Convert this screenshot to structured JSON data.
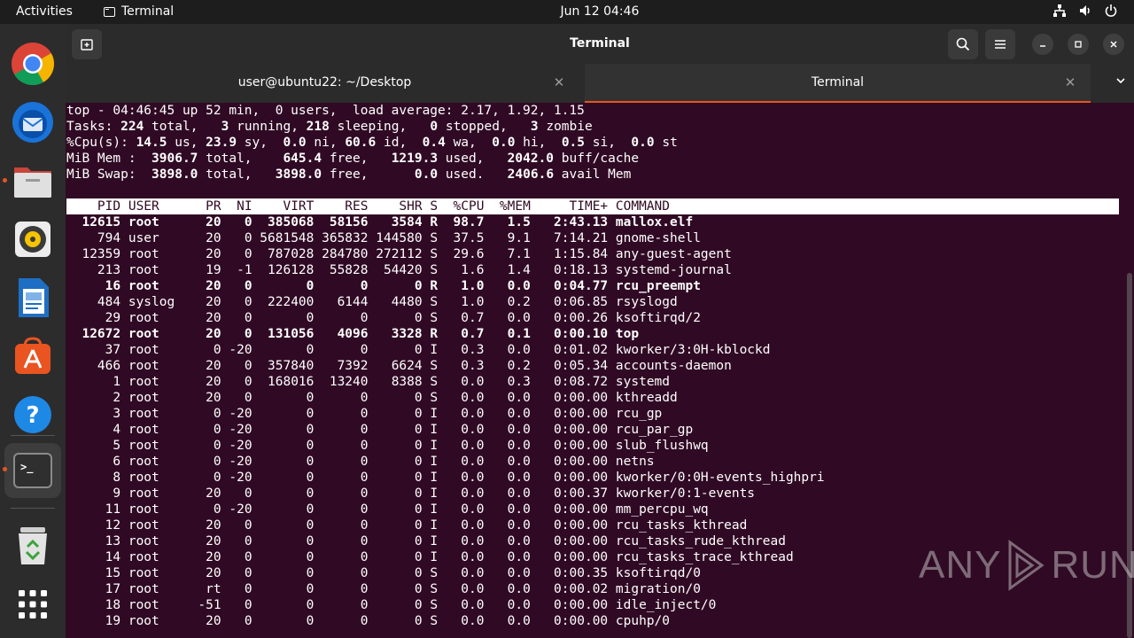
{
  "topbar": {
    "activities": "Activities",
    "app_name": "Terminal",
    "clock": "Jun 12  04:46"
  },
  "dock": {
    "items": [
      {
        "name": "chrome-icon"
      },
      {
        "name": "thunderbird-icon"
      },
      {
        "name": "files-icon"
      },
      {
        "name": "rhythmbox-icon"
      },
      {
        "name": "libreoffice-writer-icon"
      },
      {
        "name": "app-center-icon"
      },
      {
        "name": "help-icon"
      },
      {
        "name": "terminal-icon"
      },
      {
        "name": "trash-icon"
      },
      {
        "name": "show-apps-icon"
      }
    ]
  },
  "window": {
    "title": "Terminal",
    "tabs": [
      {
        "label": "user@ubuntu22: ~/Desktop"
      },
      {
        "label": "Terminal"
      }
    ]
  },
  "top": {
    "summary": [
      [
        {
          "t": "top - 04:46:45 up 52 min,  0 users,  load average: 2.17, 1.92, 1.15",
          "b": false
        }
      ],
      [
        {
          "t": "Tasks: ",
          "b": false
        },
        {
          "t": "224",
          "b": true
        },
        {
          "t": " total,   ",
          "b": false
        },
        {
          "t": "3",
          "b": true
        },
        {
          "t": " running, ",
          "b": false
        },
        {
          "t": "218",
          "b": true
        },
        {
          "t": " sleeping,   ",
          "b": false
        },
        {
          "t": "0",
          "b": true
        },
        {
          "t": " stopped,   ",
          "b": false
        },
        {
          "t": "3",
          "b": true
        },
        {
          "t": " zombie",
          "b": false
        }
      ],
      [
        {
          "t": "%Cpu(s): ",
          "b": false
        },
        {
          "t": "14.5",
          "b": true
        },
        {
          "t": " us, ",
          "b": false
        },
        {
          "t": "23.9",
          "b": true
        },
        {
          "t": " sy,  ",
          "b": false
        },
        {
          "t": "0.0",
          "b": true
        },
        {
          "t": " ni, ",
          "b": false
        },
        {
          "t": "60.6",
          "b": true
        },
        {
          "t": " id,  ",
          "b": false
        },
        {
          "t": "0.4",
          "b": true
        },
        {
          "t": " wa,  ",
          "b": false
        },
        {
          "t": "0.0",
          "b": true
        },
        {
          "t": " hi,  ",
          "b": false
        },
        {
          "t": "0.5",
          "b": true
        },
        {
          "t": " si,  ",
          "b": false
        },
        {
          "t": "0.0",
          "b": true
        },
        {
          "t": " st",
          "b": false
        }
      ],
      [
        {
          "t": "MiB Mem :  ",
          "b": false
        },
        {
          "t": "3906.7",
          "b": true
        },
        {
          "t": " total,    ",
          "b": false
        },
        {
          "t": "645.4",
          "b": true
        },
        {
          "t": " free,   ",
          "b": false
        },
        {
          "t": "1219.3",
          "b": true
        },
        {
          "t": " used,   ",
          "b": false
        },
        {
          "t": "2042.0",
          "b": true
        },
        {
          "t": " buff/cache",
          "b": false
        }
      ],
      [
        {
          "t": "MiB Swap:  ",
          "b": false
        },
        {
          "t": "3898.0",
          "b": true
        },
        {
          "t": " total,   ",
          "b": false
        },
        {
          "t": "3898.0",
          "b": true
        },
        {
          "t": " free,      ",
          "b": false
        },
        {
          "t": "0.0",
          "b": true
        },
        {
          "t": " used.   ",
          "b": false
        },
        {
          "t": "2406.6",
          "b": true
        },
        {
          "t": " avail Mem",
          "b": false
        }
      ]
    ],
    "columns": [
      "PID",
      "USER",
      "PR",
      "NI",
      "VIRT",
      "RES",
      "SHR",
      "S",
      "%CPU",
      "%MEM",
      "TIME+",
      "COMMAND"
    ],
    "processes": [
      {
        "pid": "12615",
        "user": "root",
        "pr": "20",
        "ni": "0",
        "virt": "385068",
        "res": "58156",
        "shr": "3584",
        "s": "R",
        "cpu": "98.7",
        "mem": "1.5",
        "time": "2:43.13",
        "cmd": "mallox.elf",
        "bold": true
      },
      {
        "pid": "794",
        "user": "user",
        "pr": "20",
        "ni": "0",
        "virt": "5681548",
        "res": "365832",
        "shr": "144580",
        "s": "S",
        "cpu": "37.5",
        "mem": "9.1",
        "time": "7:14.21",
        "cmd": "gnome-shell",
        "bold": false
      },
      {
        "pid": "12359",
        "user": "root",
        "pr": "20",
        "ni": "0",
        "virt": "787028",
        "res": "284780",
        "shr": "272112",
        "s": "S",
        "cpu": "29.6",
        "mem": "7.1",
        "time": "1:15.84",
        "cmd": "any-guest-agent",
        "bold": false
      },
      {
        "pid": "213",
        "user": "root",
        "pr": "19",
        "ni": "-1",
        "virt": "126128",
        "res": "55828",
        "shr": "54420",
        "s": "S",
        "cpu": "1.6",
        "mem": "1.4",
        "time": "0:18.13",
        "cmd": "systemd-journal",
        "bold": false
      },
      {
        "pid": "16",
        "user": "root",
        "pr": "20",
        "ni": "0",
        "virt": "0",
        "res": "0",
        "shr": "0",
        "s": "R",
        "cpu": "1.0",
        "mem": "0.0",
        "time": "0:04.77",
        "cmd": "rcu_preempt",
        "bold": true
      },
      {
        "pid": "484",
        "user": "syslog",
        "pr": "20",
        "ni": "0",
        "virt": "222400",
        "res": "6144",
        "shr": "4480",
        "s": "S",
        "cpu": "1.0",
        "mem": "0.2",
        "time": "0:06.85",
        "cmd": "rsyslogd",
        "bold": false
      },
      {
        "pid": "29",
        "user": "root",
        "pr": "20",
        "ni": "0",
        "virt": "0",
        "res": "0",
        "shr": "0",
        "s": "S",
        "cpu": "0.7",
        "mem": "0.0",
        "time": "0:00.26",
        "cmd": "ksoftirqd/2",
        "bold": false
      },
      {
        "pid": "12672",
        "user": "root",
        "pr": "20",
        "ni": "0",
        "virt": "131056",
        "res": "4096",
        "shr": "3328",
        "s": "R",
        "cpu": "0.7",
        "mem": "0.1",
        "time": "0:00.10",
        "cmd": "top",
        "bold": true
      },
      {
        "pid": "37",
        "user": "root",
        "pr": "0",
        "ni": "-20",
        "virt": "0",
        "res": "0",
        "shr": "0",
        "s": "I",
        "cpu": "0.3",
        "mem": "0.0",
        "time": "0:01.02",
        "cmd": "kworker/3:0H-kblockd",
        "bold": false
      },
      {
        "pid": "466",
        "user": "root",
        "pr": "20",
        "ni": "0",
        "virt": "357840",
        "res": "7392",
        "shr": "6624",
        "s": "S",
        "cpu": "0.3",
        "mem": "0.2",
        "time": "0:05.34",
        "cmd": "accounts-daemon",
        "bold": false
      },
      {
        "pid": "1",
        "user": "root",
        "pr": "20",
        "ni": "0",
        "virt": "168016",
        "res": "13240",
        "shr": "8388",
        "s": "S",
        "cpu": "0.0",
        "mem": "0.3",
        "time": "0:08.72",
        "cmd": "systemd",
        "bold": false
      },
      {
        "pid": "2",
        "user": "root",
        "pr": "20",
        "ni": "0",
        "virt": "0",
        "res": "0",
        "shr": "0",
        "s": "S",
        "cpu": "0.0",
        "mem": "0.0",
        "time": "0:00.00",
        "cmd": "kthreadd",
        "bold": false
      },
      {
        "pid": "3",
        "user": "root",
        "pr": "0",
        "ni": "-20",
        "virt": "0",
        "res": "0",
        "shr": "0",
        "s": "I",
        "cpu": "0.0",
        "mem": "0.0",
        "time": "0:00.00",
        "cmd": "rcu_gp",
        "bold": false
      },
      {
        "pid": "4",
        "user": "root",
        "pr": "0",
        "ni": "-20",
        "virt": "0",
        "res": "0",
        "shr": "0",
        "s": "I",
        "cpu": "0.0",
        "mem": "0.0",
        "time": "0:00.00",
        "cmd": "rcu_par_gp",
        "bold": false
      },
      {
        "pid": "5",
        "user": "root",
        "pr": "0",
        "ni": "-20",
        "virt": "0",
        "res": "0",
        "shr": "0",
        "s": "I",
        "cpu": "0.0",
        "mem": "0.0",
        "time": "0:00.00",
        "cmd": "slub_flushwq",
        "bold": false
      },
      {
        "pid": "6",
        "user": "root",
        "pr": "0",
        "ni": "-20",
        "virt": "0",
        "res": "0",
        "shr": "0",
        "s": "I",
        "cpu": "0.0",
        "mem": "0.0",
        "time": "0:00.00",
        "cmd": "netns",
        "bold": false
      },
      {
        "pid": "8",
        "user": "root",
        "pr": "0",
        "ni": "-20",
        "virt": "0",
        "res": "0",
        "shr": "0",
        "s": "I",
        "cpu": "0.0",
        "mem": "0.0",
        "time": "0:00.00",
        "cmd": "kworker/0:0H-events_highpri",
        "bold": false
      },
      {
        "pid": "9",
        "user": "root",
        "pr": "20",
        "ni": "0",
        "virt": "0",
        "res": "0",
        "shr": "0",
        "s": "I",
        "cpu": "0.0",
        "mem": "0.0",
        "time": "0:00.37",
        "cmd": "kworker/0:1-events",
        "bold": false
      },
      {
        "pid": "11",
        "user": "root",
        "pr": "0",
        "ni": "-20",
        "virt": "0",
        "res": "0",
        "shr": "0",
        "s": "I",
        "cpu": "0.0",
        "mem": "0.0",
        "time": "0:00.00",
        "cmd": "mm_percpu_wq",
        "bold": false
      },
      {
        "pid": "12",
        "user": "root",
        "pr": "20",
        "ni": "0",
        "virt": "0",
        "res": "0",
        "shr": "0",
        "s": "I",
        "cpu": "0.0",
        "mem": "0.0",
        "time": "0:00.00",
        "cmd": "rcu_tasks_kthread",
        "bold": false
      },
      {
        "pid": "13",
        "user": "root",
        "pr": "20",
        "ni": "0",
        "virt": "0",
        "res": "0",
        "shr": "0",
        "s": "I",
        "cpu": "0.0",
        "mem": "0.0",
        "time": "0:00.00",
        "cmd": "rcu_tasks_rude_kthread",
        "bold": false
      },
      {
        "pid": "14",
        "user": "root",
        "pr": "20",
        "ni": "0",
        "virt": "0",
        "res": "0",
        "shr": "0",
        "s": "I",
        "cpu": "0.0",
        "mem": "0.0",
        "time": "0:00.00",
        "cmd": "rcu_tasks_trace_kthread",
        "bold": false
      },
      {
        "pid": "15",
        "user": "root",
        "pr": "20",
        "ni": "0",
        "virt": "0",
        "res": "0",
        "shr": "0",
        "s": "S",
        "cpu": "0.0",
        "mem": "0.0",
        "time": "0:00.35",
        "cmd": "ksoftirqd/0",
        "bold": false
      },
      {
        "pid": "17",
        "user": "root",
        "pr": "rt",
        "ni": "0",
        "virt": "0",
        "res": "0",
        "shr": "0",
        "s": "S",
        "cpu": "0.0",
        "mem": "0.0",
        "time": "0:00.02",
        "cmd": "migration/0",
        "bold": false
      },
      {
        "pid": "18",
        "user": "root",
        "pr": "-51",
        "ni": "0",
        "virt": "0",
        "res": "0",
        "shr": "0",
        "s": "S",
        "cpu": "0.0",
        "mem": "0.0",
        "time": "0:00.00",
        "cmd": "idle_inject/0",
        "bold": false
      },
      {
        "pid": "19",
        "user": "root",
        "pr": "20",
        "ni": "0",
        "virt": "0",
        "res": "0",
        "shr": "0",
        "s": "S",
        "cpu": "0.0",
        "mem": "0.0",
        "time": "0:00.00",
        "cmd": "cpuhp/0",
        "bold": false
      }
    ]
  },
  "watermark": {
    "text_left": "ANY",
    "text_right": "RUN"
  },
  "colors": {
    "terminal_bg": "#300a24",
    "accent": "#e95420"
  }
}
